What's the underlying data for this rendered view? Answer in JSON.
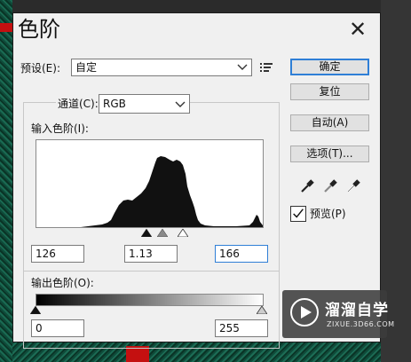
{
  "dialog": {
    "title": "色阶",
    "close_glyph": "✕"
  },
  "preset": {
    "label": "预设(E):",
    "value": "自定"
  },
  "channel": {
    "label": "通道(C):",
    "value": "RGB"
  },
  "input_levels": {
    "label": "输入色阶(I):",
    "black": "126",
    "gamma": "1.13",
    "white": "166",
    "black_fraction": 0.494,
    "gamma_fraction": 0.565,
    "white_fraction": 0.651
  },
  "output_levels": {
    "label": "输出色阶(O):",
    "black": "0",
    "white": "255"
  },
  "buttons": {
    "ok": "确定",
    "reset": "复位",
    "auto": "自动(A)",
    "options": "选项(T)..."
  },
  "preview": {
    "label": "预览(P)",
    "checked": true
  },
  "watermark": {
    "name": "溜溜自学",
    "url": "ZIXUE.3D66.COM"
  },
  "icons": {
    "close": "close-icon",
    "dropdown": "chevron-down-icon",
    "preset_menu": "list-menu-icon",
    "black_eyedropper": "black-eyedropper-icon",
    "gray_eyedropper": "gray-eyedropper-icon",
    "white_eyedropper": "white-eyedropper-icon",
    "checkmark": "checkmark-icon"
  },
  "colors": {
    "accent": "#2f7fd6",
    "dialog_bg": "#f0f0f0",
    "histogram": "#111111"
  }
}
